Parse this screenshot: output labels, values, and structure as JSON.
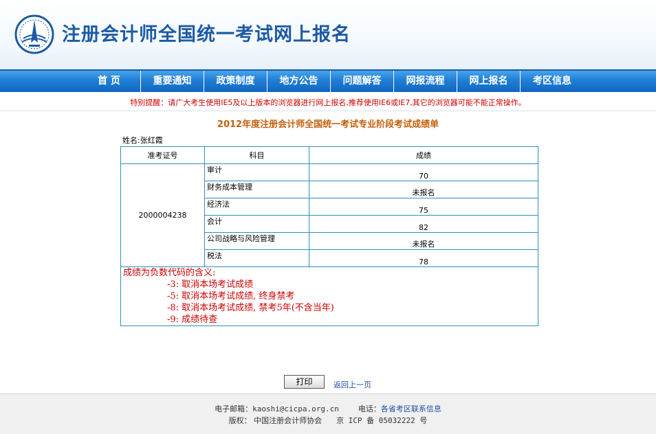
{
  "header": {
    "site_title": "注册会计师全国统一考试网上报名",
    "logo_icon": "cicpa-logo-icon",
    "brand_color": "#1d5aa5"
  },
  "nav": {
    "items": [
      "首 页",
      "重要通知",
      "政策制度",
      "地方公告",
      "问题解答",
      "网报流程",
      "网上报名",
      "考区信息"
    ]
  },
  "notice": "特别提醒：请广大考生使用IE5及以上版本的浏览器进行网上报名,推荐使用IE6或IE7,其它的浏览器可能不能正常操作。",
  "report": {
    "title": "2012年度注册会计师全国统一考试专业阶段考试成绩单",
    "student_label": "姓名:张红霞",
    "headers": {
      "exam_id": "准考证号",
      "subject": "科目",
      "score": "成绩"
    },
    "exam_id": "2000004238",
    "rows": [
      {
        "subject": "审计",
        "score": "70"
      },
      {
        "subject": "财务成本管理",
        "score": "未报名"
      },
      {
        "subject": "经济法",
        "score": "75"
      },
      {
        "subject": "会计",
        "score": "82"
      },
      {
        "subject": "公司战略与风险管理",
        "score": "未报名"
      },
      {
        "subject": "税法",
        "score": "78"
      }
    ],
    "notes_title": "成绩为负数代码的含义:",
    "notes": [
      "-3: 取消本场考试成绩",
      "-5: 取消本场考试成绩, 终身禁考",
      "-8: 取消本场考试成绩, 禁考5年(不含当年)",
      "-9: 成绩待查"
    ]
  },
  "actions": {
    "print_label": "打印",
    "back_label": "返回上一页"
  },
  "footer": {
    "email_label": "电子邮箱：",
    "email": "kaoshi@cicpa.org.cn",
    "phone_label": "电话：",
    "phone_link": "各省考区联系信息",
    "copyright_label": "版权：",
    "copyright_owner": "中国注册会计师协会",
    "icp": "京 ICP 备 05032222 号"
  }
}
